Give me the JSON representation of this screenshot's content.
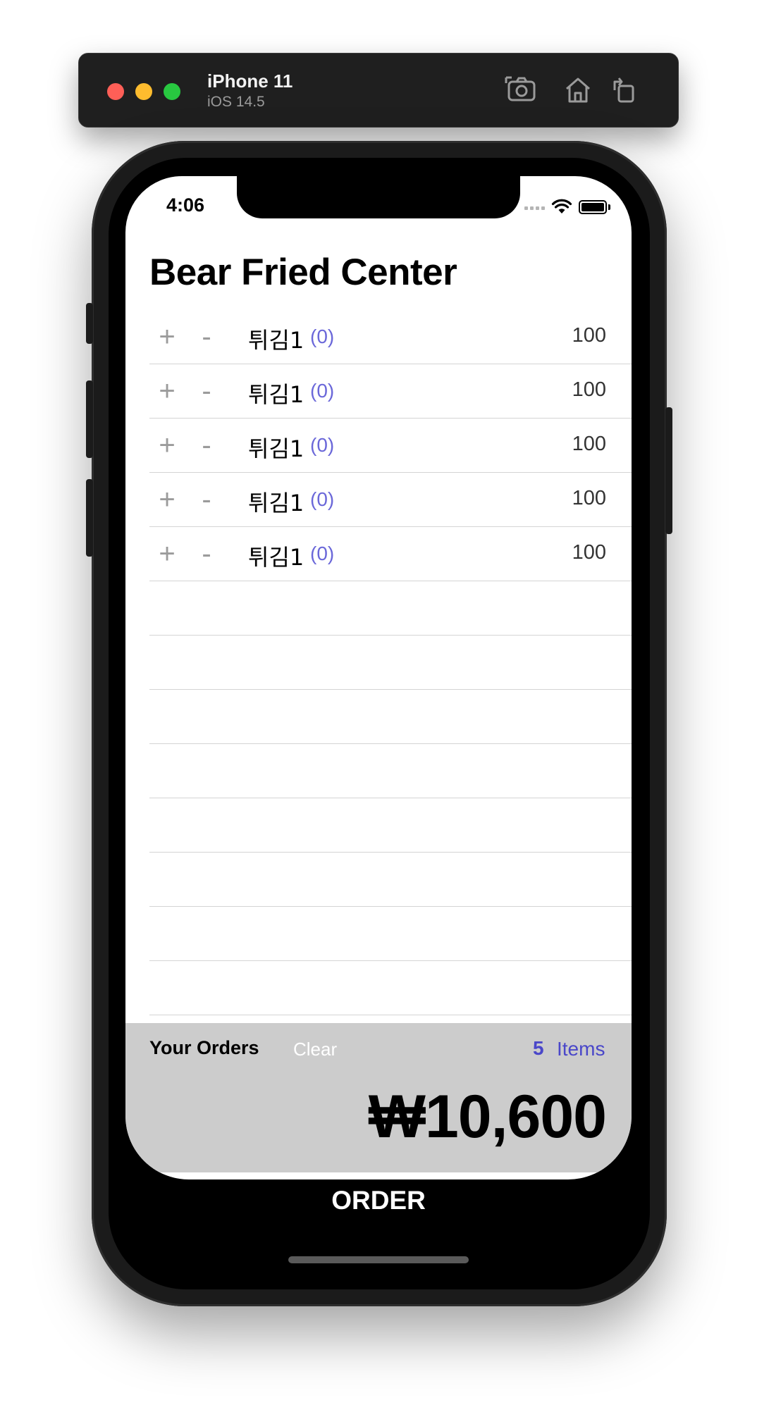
{
  "simulator": {
    "device_name": "iPhone 11",
    "os_version": "iOS 14.5",
    "tools": [
      "screenshot-icon",
      "home-icon",
      "rotate-icon"
    ]
  },
  "status_bar": {
    "time": "4:06"
  },
  "page": {
    "title": "Bear Fried Center"
  },
  "menu": {
    "plus_symbol": "+",
    "minus_symbol": "-",
    "items": [
      {
        "name": "튀김1",
        "count": "(0)",
        "price": "100"
      },
      {
        "name": "튀김1",
        "count": "(0)",
        "price": "100"
      },
      {
        "name": "튀김1",
        "count": "(0)",
        "price": "100"
      },
      {
        "name": "튀김1",
        "count": "(0)",
        "price": "100"
      },
      {
        "name": "튀김1",
        "count": "(0)",
        "price": "100"
      }
    ]
  },
  "summary": {
    "label": "Your Orders",
    "clear_label": "Clear",
    "items_count": "5",
    "items_label": "Items",
    "total": "₩10,600"
  },
  "order_button": {
    "label": "ORDER"
  },
  "colors": {
    "accent": "#4a47c9",
    "count_color": "#6b68d9",
    "summary_bg": "#cccccc"
  }
}
